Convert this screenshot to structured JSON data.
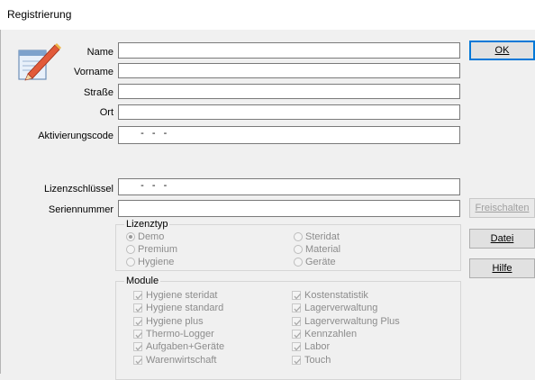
{
  "window": {
    "title": "Registrierung"
  },
  "form": {
    "name_label": "Name",
    "name_value": "",
    "vorname_label": "Vorname",
    "vorname_value": "",
    "strasse_label": "Straße",
    "strasse_value": "",
    "ort_label": "Ort",
    "ort_value": "",
    "aktivierungscode_label": "Aktivierungscode",
    "aktivierungscode_value": "  -  -  -",
    "lizenzschluessel_label": "Lizenzschlüssel",
    "lizenzschluessel_value": "  -  -  -",
    "seriennummer_label": "Seriennummer",
    "seriennummer_value": ""
  },
  "buttons": {
    "ok_label": "OK",
    "freischalten_label": "Freischalten",
    "datei_label": "Datei",
    "hilfe_label": "Hilfe"
  },
  "lizenztyp": {
    "title": "Lizenztyp",
    "selected": "Demo",
    "options": [
      "Demo",
      "Steridat",
      "Premium",
      "Material",
      "Hygiene",
      "Geräte"
    ]
  },
  "module": {
    "title": "Module",
    "items": [
      "Hygiene steridat",
      "Kostenstatistik",
      "Hygiene standard",
      "Lagerverwaltung",
      "Hygiene plus",
      "Lagerverwaltung Plus",
      "Thermo-Logger",
      "Kennzahlen",
      "Aufgaben+Geräte",
      "Labor",
      "Warenwirtschaft",
      "Touch"
    ]
  },
  "icons": {
    "app": "registration-pen-icon"
  },
  "colors": {
    "accent": "#0078d7",
    "disabled_text": "#8c8c8c"
  }
}
